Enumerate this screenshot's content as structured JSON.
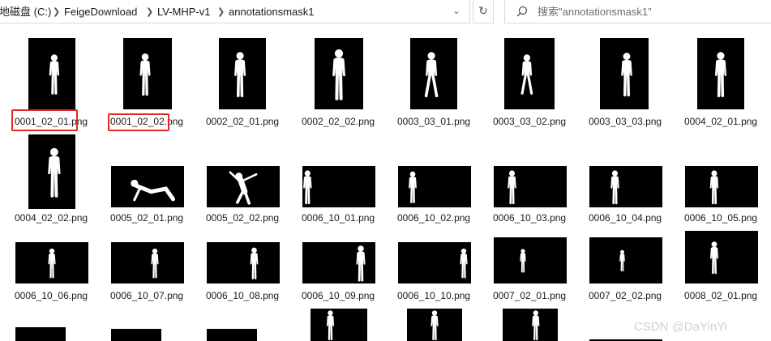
{
  "address_bar": {
    "crumbs": [
      "地磁盘 (C:)",
      "FeigeDownload",
      "LV-MHP-v1",
      "annotationsmask1"
    ],
    "separator_icon": "chevron-right-icon",
    "dropdown_icon": "chevron-down-icon",
    "refresh_icon": "refresh-icon"
  },
  "search": {
    "placeholder": "搜索\"annotationsmask1\"",
    "icon": "search-icon"
  },
  "files": [
    {
      "name": "0001_02_01.png",
      "orientation": "portrait",
      "pose": "stand"
    },
    {
      "name": "0001_02_02.png",
      "orientation": "portrait",
      "pose": "stand"
    },
    {
      "name": "0002_02_01.png",
      "orientation": "portrait",
      "pose": "stand"
    },
    {
      "name": "0002_02_02.png",
      "orientation": "portrait",
      "pose": "stand"
    },
    {
      "name": "0003_03_01.png",
      "orientation": "portrait",
      "pose": "walk"
    },
    {
      "name": "0003_03_02.png",
      "orientation": "portrait",
      "pose": "walk"
    },
    {
      "name": "0003_03_03.png",
      "orientation": "portrait",
      "pose": "stand"
    },
    {
      "name": "0004_02_01.png",
      "orientation": "portrait",
      "pose": "stand"
    },
    {
      "name": "0004_02_02.png",
      "orientation": "portrait",
      "pose": "stand"
    },
    {
      "name": "0005_02_01.png",
      "orientation": "landscape",
      "pose": "crouch"
    },
    {
      "name": "0005_02_02.png",
      "orientation": "landscape",
      "pose": "dance"
    },
    {
      "name": "0006_10_01.png",
      "orientation": "landscape",
      "pose": "stand"
    },
    {
      "name": "0006_10_02.png",
      "orientation": "landscape",
      "pose": "stand"
    },
    {
      "name": "0006_10_03.png",
      "orientation": "landscape",
      "pose": "stand"
    },
    {
      "name": "0006_10_04.png",
      "orientation": "landscape",
      "pose": "stand"
    },
    {
      "name": "0006_10_05.png",
      "orientation": "landscape",
      "pose": "stand"
    },
    {
      "name": "0006_10_06.png",
      "orientation": "landscape",
      "pose": "stand"
    },
    {
      "name": "0006_10_07.png",
      "orientation": "landscape",
      "pose": "stand"
    },
    {
      "name": "0006_10_08.png",
      "orientation": "landscape",
      "pose": "stand"
    },
    {
      "name": "0006_10_09.png",
      "orientation": "landscape",
      "pose": "stand"
    },
    {
      "name": "0006_10_10.png",
      "orientation": "landscape",
      "pose": "stand"
    },
    {
      "name": "0007_02_01.png",
      "orientation": "landscape",
      "pose": "stand"
    },
    {
      "name": "0007_02_02.png",
      "orientation": "landscape",
      "pose": "stand"
    },
    {
      "name": "0008_02_01.png",
      "orientation": "landscape",
      "pose": "stand"
    },
    {
      "name": "",
      "orientation": "partial",
      "pose": "none"
    },
    {
      "name": "",
      "orientation": "partial",
      "pose": "none"
    },
    {
      "name": "",
      "orientation": "partial",
      "pose": "none"
    },
    {
      "name": "",
      "orientation": "partial",
      "pose": "stand"
    },
    {
      "name": "",
      "orientation": "partial",
      "pose": "stand"
    },
    {
      "name": "",
      "orientation": "partial",
      "pose": "stand"
    },
    {
      "name": "",
      "orientation": "partial",
      "pose": "none"
    }
  ],
  "highlight": {
    "color": "#e02828",
    "marked": [
      {
        "file": "0001_02_01.png",
        "boxed_text": "0001_02_01."
      },
      {
        "file": "0001_02_02.png",
        "boxed_text": "0001_02_02."
      }
    ]
  },
  "watermark": "CSDN @DaYinYi",
  "colors": {
    "thumbnail_bg": "#000000",
    "silhouette": "#ffffff",
    "highlight": "#e02828"
  }
}
